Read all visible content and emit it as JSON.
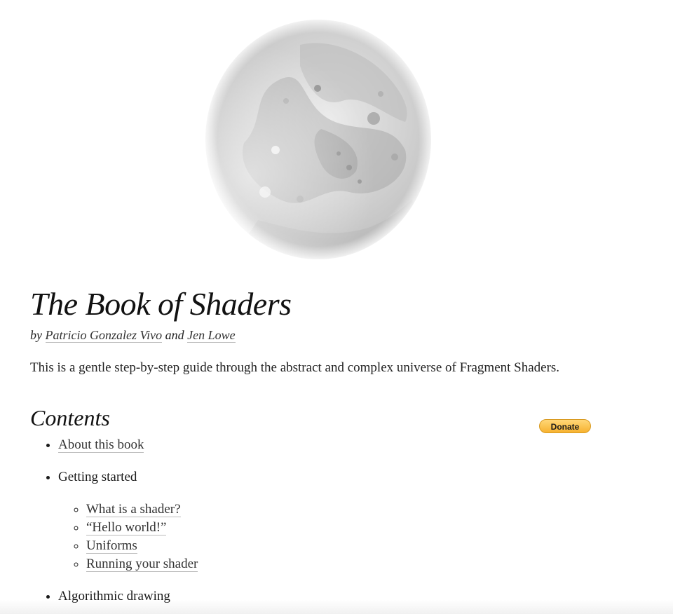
{
  "hero": {
    "image_name": "moon-illustration"
  },
  "title": "The Book of Shaders",
  "byline": {
    "prefix": "by",
    "author1": "Patricio Gonzalez Vivo",
    "conjunction": "and",
    "author2": "Jen Lowe"
  },
  "intro": "This is a gentle step-by-step guide through the abstract and complex universe of Fragment Shaders.",
  "contents": {
    "heading": "Contents",
    "donate_label": "Donate",
    "items": [
      {
        "label": "About this book",
        "link": true
      },
      {
        "label": "Getting started",
        "link": false,
        "children": [
          {
            "label": "What is a shader?"
          },
          {
            "label": "“Hello world!”"
          },
          {
            "label": "Uniforms"
          },
          {
            "label": "Running your shader"
          }
        ]
      },
      {
        "label": "Algorithmic drawing",
        "link": false
      }
    ]
  },
  "colors": {
    "text": "#1a1a1a",
    "link_underline": "#bbbbbb",
    "donate_top": "#ffd778",
    "donate_bottom": "#f7b230"
  }
}
